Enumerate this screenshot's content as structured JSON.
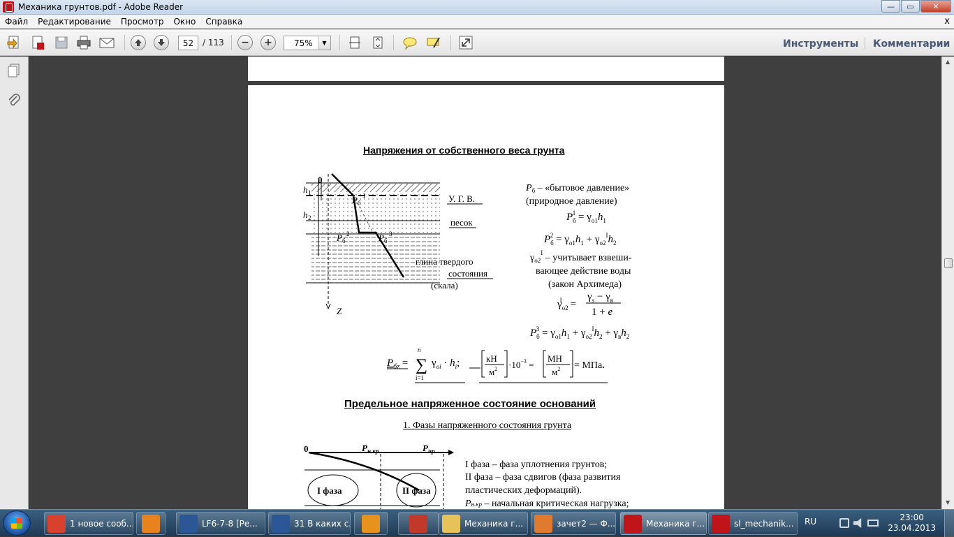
{
  "window": {
    "title": "Механика грунтов.pdf - Adobe Reader",
    "buttons": {
      "minimize": "—",
      "maximize": "▭",
      "close": "✕"
    }
  },
  "menu": {
    "items": [
      "Файл",
      "Редактирование",
      "Просмотр",
      "Окно",
      "Справка"
    ],
    "close_doc": "x"
  },
  "toolbar": {
    "current_page": "52",
    "total_pages": "/ 113",
    "zoom": "75%",
    "tools_label": "Инструменты",
    "comments_label": "Комментарии"
  },
  "document": {
    "heading1": "Напряжения от собственного веса грунта",
    "fig1": {
      "zero": "0",
      "h1": "h",
      "h1_sub": "1",
      "h2": "h",
      "h2_sub": "2",
      "z": "Z",
      "pb1": "P",
      "pb1_sub": "б",
      "pb1_sup": "1",
      "pb2": "P",
      "pb2_sub": "б",
      "pb2_sup": "2",
      "pb3": "P",
      "pb3_sub": "б",
      "pb3_sup": "3",
      "ugv": "У. Г. В.",
      "sand": "песок",
      "clay1": "глина твердого",
      "clay2": "состояния",
      "rock": "(скала)"
    },
    "right_text": {
      "line1": "P",
      "line1_sub": "б",
      "line1_rest": " – «бытовое давление»",
      "line2": "(природное давление)",
      "f1": "P",
      "f1_sub": "б",
      "f1_sup": "1",
      "f1_rest": " = γ",
      "f1_sub2": "o1",
      "f1_end": "h",
      "f1_end_sub": "1",
      "f2": "P",
      "f2_sub": "б",
      "f2_sup": "2",
      "f2_rest": " = γ",
      "f2_a": "o1",
      "f2_b": "h",
      "f2_b_sub": "1",
      "f2_c": " + γ",
      "f2_c_sub": "o2",
      "f2_c_sup": "I",
      "f2_d": "h",
      "f2_d_sub": "2",
      "g_line1": "γ",
      "g_line1_sub": "o2",
      "g_line1_sup": "I",
      "g_line1_rest": " – учитывает взвеши-",
      "g_line2": "вающее действие воды",
      "g_line3": "(закон Архимеда)",
      "g_formula_lhs": "γ",
      "g_formula_lhs_sub": "o2",
      "g_formula_lhs_sup": "I",
      "g_formula_eq": "=",
      "g_formula_num": "γ",
      "g_formula_num_sub": "s",
      "g_formula_num_mid": " − γ",
      "g_formula_num_sub2": "в",
      "g_formula_den": "1 + ",
      "g_formula_den_e": "e",
      "f3": "P",
      "f3_sub": "б",
      "f3_sup": "3",
      "f3_rest": " = γ",
      "f3_a": "o1",
      "f3_b": "h",
      "f3_b_sub": "1",
      "f3_c": " + γ",
      "f3_c_sub": "o2",
      "f3_c_sup": "I",
      "f3_d": "h",
      "f3_d_sub": "2",
      "f3_e": " + γ",
      "f3_e_sub": "в",
      "f3_f": "h",
      "f3_f_sub": "2"
    },
    "sum_formula": {
      "lhs": "P",
      "lhs_sub": "бz",
      "eq": " = ",
      "sum": "∑",
      "sum_top": "n",
      "sum_bot": "i=1",
      "term": "γ",
      "term_sub": "oi",
      "dot": " · ",
      "h": "h",
      "h_sub": "i",
      "semi": ";",
      "u1_num": "кН",
      "u1_den": "м",
      "u1_den_sup": "2",
      "mult": "·10",
      "mult_sup": "−3",
      "eq2": " = ",
      "u2_num": "МН",
      "u2_den": "м",
      "u2_den_sup": "2",
      "eq3": " = МПа",
      "end": "."
    },
    "heading2": "Предельное напряженное состояние оснований",
    "subheading": "1. Фазы напряженного состояния грунта",
    "fig2": {
      "zero": "0",
      "pnkr": "P",
      "pnkr_sub": "н.кр",
      "ppr": "P",
      "ppr_sub": "пр",
      "phase1": "I фаза",
      "phase2": "II фаза"
    },
    "phases_text": {
      "l1": "I фаза – фаза уплотнения грунтов;",
      "l2": "II фаза – фаза сдвигов (фаза развития",
      "l3": "пластических деформаций).",
      "l4_p": "P",
      "l4_sub": "н.кр",
      "l4_rest": " – начальная критическая нагрузка;"
    }
  },
  "taskbar": {
    "items": [
      {
        "label": "1 новое сооб...",
        "icon": "chrome-icon",
        "color": "#d9412f"
      },
      {
        "label": "",
        "icon": "media-player-icon",
        "color": "#e8821e"
      },
      {
        "label": "LF6-7-8 [Ре...",
        "icon": "word-icon",
        "color": "#2b5797"
      },
      {
        "label": "31 В каких с...",
        "icon": "word-icon",
        "color": "#2b5797"
      },
      {
        "label": "",
        "icon": "apps-icon",
        "color": "#e8921e"
      },
      {
        "label": "",
        "icon": "picture-viewer-icon",
        "color": "#c0392b"
      },
      {
        "label": "Механика г...",
        "icon": "folder-icon",
        "color": "#e6c25a"
      },
      {
        "label": "зачет2 — Ф...",
        "icon": "paint-icon",
        "color": "#e07a2e"
      },
      {
        "label": "Механика г...",
        "icon": "pdf-icon",
        "color": "#c0141b"
      },
      {
        "label": "sl_mechanik...",
        "icon": "pdf-icon",
        "color": "#c0141b"
      }
    ],
    "lang": "RU",
    "time": "23:00",
    "date": "23.04.2013"
  }
}
